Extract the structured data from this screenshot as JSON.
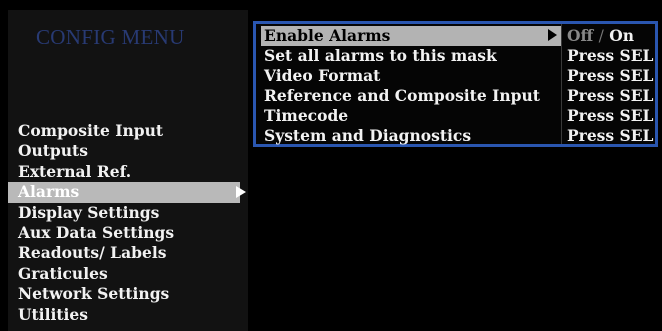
{
  "config_menu": {
    "title": "CONFIG MENU"
  },
  "left_menu": {
    "items": [
      {
        "label": "Composite Input"
      },
      {
        "label": "Outputs"
      },
      {
        "label": "External Ref."
      },
      {
        "label": "Alarms"
      },
      {
        "label": "Display Settings"
      },
      {
        "label": "Aux Data Settings"
      },
      {
        "label": "Readouts/ Labels"
      },
      {
        "label": "Graticules"
      },
      {
        "label": "Network Settings"
      },
      {
        "label": "Utilities"
      }
    ],
    "selected_index": 3
  },
  "alarms_submenu": {
    "items": [
      {
        "label": "Enable Alarms",
        "value_off": "Off",
        "value_sep": "/",
        "value_on": "On"
      },
      {
        "label": "Set all alarms to this mask",
        "value": "Press SEL"
      },
      {
        "label": "Video Format",
        "value": "Press SEL"
      },
      {
        "label": "Reference and Composite Input",
        "value": "Press SEL"
      },
      {
        "label": "Timecode",
        "value": "Press SEL"
      },
      {
        "label": "System and Diagnostics",
        "value": "Press SEL"
      }
    ],
    "selected_index": 0
  },
  "colors": {
    "title": "#283a73",
    "border": "#2a56b0",
    "highlight": "#b9b9b9"
  },
  "icons": {
    "selected_arrow": "triangle-right-icon"
  }
}
